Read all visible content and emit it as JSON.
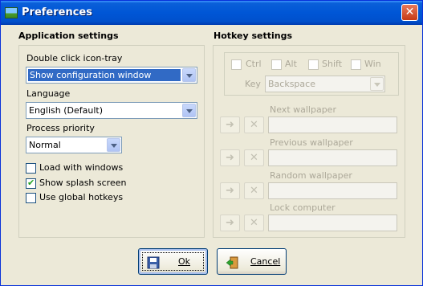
{
  "window": {
    "title": "Preferences",
    "close_glyph": "✕"
  },
  "app_settings": {
    "title": "Application settings",
    "double_click_label": "Double click icon-tray",
    "double_click_value": "Show configuration window",
    "language_label": "Language",
    "language_value": "English (Default)",
    "priority_label": "Process priority",
    "priority_value": "Normal",
    "checkboxes": [
      {
        "label": "Load with windows",
        "checked": false
      },
      {
        "label": "Show splash screen",
        "checked": true
      },
      {
        "label": "Use global hotkeys",
        "checked": false
      }
    ]
  },
  "hotkey_settings": {
    "title": "Hotkey settings",
    "modifiers": [
      "Ctrl",
      "Alt",
      "Shift",
      "Win"
    ],
    "key_label": "Key",
    "key_value": "Backspace",
    "actions": [
      {
        "label": "Next wallpaper",
        "value": ""
      },
      {
        "label": "Previous wallpaper",
        "value": ""
      },
      {
        "label": "Random wallpaper",
        "value": ""
      },
      {
        "label": "Lock computer",
        "value": ""
      }
    ],
    "assign_icon": "arrow-right-icon",
    "clear_icon": "x-icon"
  },
  "buttons": {
    "ok": "Ok",
    "cancel": "Cancel"
  }
}
